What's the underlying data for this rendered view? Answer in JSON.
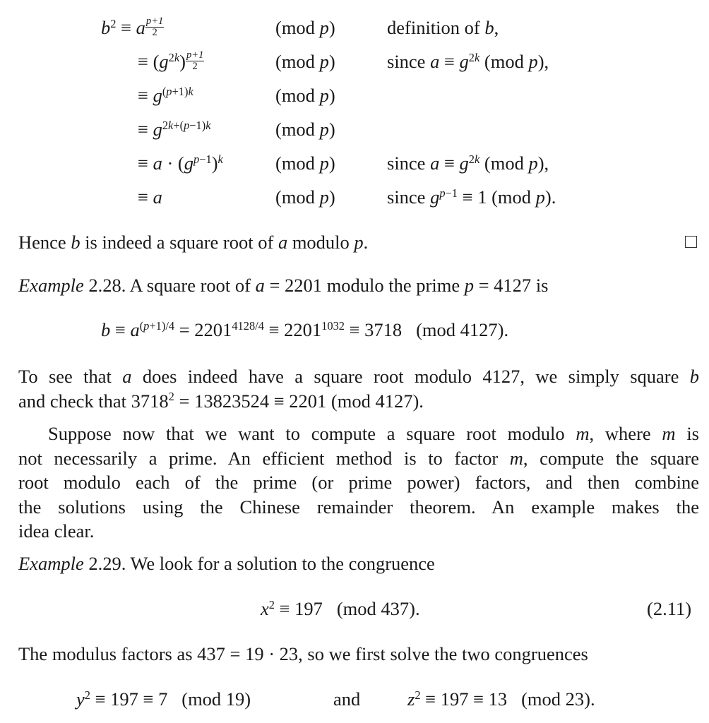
{
  "align_derivation": {
    "rows": [
      {
        "lhs": "b²",
        "rel": "≡",
        "rhs": "a^((p+1)/2)",
        "mod": "(mod p)",
        "reason": "definition of b,"
      },
      {
        "lhs": "",
        "rel": "≡",
        "rhs": "(g^(2k))^((p+1)/2)",
        "mod": "(mod p)",
        "reason": "since a ≡ g^(2k) (mod p),"
      },
      {
        "lhs": "",
        "rel": "≡",
        "rhs": "g^((p+1)k)",
        "mod": "(mod p)",
        "reason": ""
      },
      {
        "lhs": "",
        "rel": "≡",
        "rhs": "g^(2k+(p−1)k)",
        "mod": "(mod p)",
        "reason": ""
      },
      {
        "lhs": "",
        "rel": "≡",
        "rhs": "a · (g^(p−1))^k",
        "mod": "(mod p)",
        "reason": "since a ≡ g^(2k) (mod p),"
      },
      {
        "lhs": "",
        "rel": "≡",
        "rhs": "a",
        "mod": "(mod p)",
        "reason": "since g^(p−1) ≡ 1 (mod p)."
      }
    ],
    "mod_label": "(mod ",
    "mod_var": "p",
    "mod_close": ")",
    "reason_definition": "definition of ",
    "reason_since": "since "
  },
  "conclusion": {
    "text_1": "Hence ",
    "var_b": "b",
    "text_2": " is indeed a square root of ",
    "var_a": "a",
    "text_3": " modulo ",
    "var_p": "p",
    "text_4": ".",
    "qed_symbol": "□"
  },
  "example_228": {
    "label": "Example",
    "number": " 2.28.",
    "text_1": " A square root of ",
    "a_eq": " = 2201",
    "text_2": " modulo the prime ",
    "p_eq": " = 4127",
    "text_3": " is",
    "display": "b ≡ a^((p+1)/4) = 2201^(4128/4) ≡ 2201^1032 ≡ 3718 (mod 4127).",
    "disp_eq1": " = 2201",
    "disp_exp1": "4128/4",
    "disp_eq2": " ≡ 2201",
    "disp_exp2": "1032",
    "disp_eq3": " ≡ 3718",
    "disp_mod": "(mod 4127)."
  },
  "check_paragraph": {
    "line1_a": "To see that ",
    "line1_b": " does indeed have a square root modulo 4127, we simply square ",
    "line2_a": "and check that 3718",
    "line2_b": " = 13823524 ≡ 2201 (mod 4127)."
  },
  "suppose_paragraph": {
    "lines": [
      "Suppose now that we want to compute a square root modulo m, where m is",
      "not necessarily a prime. An efficient method is to factor m, compute the square",
      "root modulo each of the prime (or prime power) factors, and then combine",
      "the solutions using the Chinese remainder theorem. An example makes the",
      "idea clear."
    ],
    "l1_a": "Suppose now that we want to compute a square root modulo ",
    "l1_b": ", where ",
    "l1_c": " is",
    "l2_a": "not necessarily a prime. An efficient method is to factor ",
    "l2_b": ", compute the square",
    "l3": "root modulo each of the prime (or prime power) factors, and then combine",
    "l4": "the solutions using the Chinese remainder theorem. An example makes the",
    "l5": "idea clear."
  },
  "example_229": {
    "label": "Example",
    "number": " 2.29.",
    "text": " We look for a solution to the congruence",
    "display_rhs": " ≡ 197",
    "display_mod": "(mod 437).",
    "equation_number": "(2.11)"
  },
  "modulus_paragraph": {
    "text": "The modulus factors as 437 = 19 · 23, so we first solve the two congruences"
  },
  "two_congruences": {
    "left_rhs": " ≡ 197 ≡ 7",
    "left_mod": "(mod 19)",
    "connector": "and",
    "right_rhs": " ≡ 197 ≡ 13",
    "right_mod": "(mod 23)."
  },
  "symbols": {
    "b": "b",
    "a": "a",
    "p": "p",
    "g": "g",
    "k": "k",
    "m": "m",
    "x": "x",
    "y": "y",
    "z": "z",
    "two": "2",
    "equiv": "≡",
    "dot": "·"
  }
}
